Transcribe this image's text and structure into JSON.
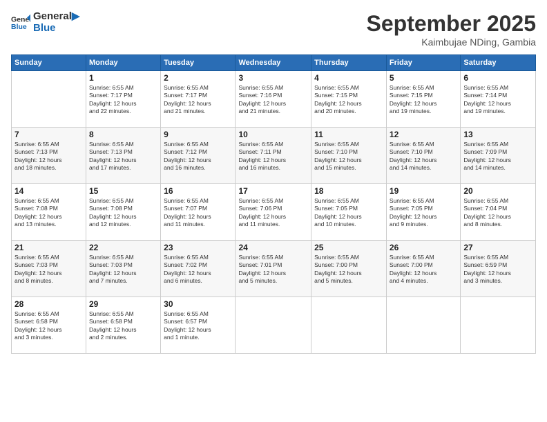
{
  "logo": {
    "line1": "General",
    "line2": "Blue"
  },
  "title": "September 2025",
  "location": "Kaimbujae NDing, Gambia",
  "days_of_week": [
    "Sunday",
    "Monday",
    "Tuesday",
    "Wednesday",
    "Thursday",
    "Friday",
    "Saturday"
  ],
  "weeks": [
    [
      {
        "day": "",
        "info": ""
      },
      {
        "day": "1",
        "info": "Sunrise: 6:55 AM\nSunset: 7:17 PM\nDaylight: 12 hours\nand 22 minutes."
      },
      {
        "day": "2",
        "info": "Sunrise: 6:55 AM\nSunset: 7:17 PM\nDaylight: 12 hours\nand 21 minutes."
      },
      {
        "day": "3",
        "info": "Sunrise: 6:55 AM\nSunset: 7:16 PM\nDaylight: 12 hours\nand 21 minutes."
      },
      {
        "day": "4",
        "info": "Sunrise: 6:55 AM\nSunset: 7:15 PM\nDaylight: 12 hours\nand 20 minutes."
      },
      {
        "day": "5",
        "info": "Sunrise: 6:55 AM\nSunset: 7:15 PM\nDaylight: 12 hours\nand 19 minutes."
      },
      {
        "day": "6",
        "info": "Sunrise: 6:55 AM\nSunset: 7:14 PM\nDaylight: 12 hours\nand 19 minutes."
      }
    ],
    [
      {
        "day": "7",
        "info": "Sunrise: 6:55 AM\nSunset: 7:13 PM\nDaylight: 12 hours\nand 18 minutes."
      },
      {
        "day": "8",
        "info": "Sunrise: 6:55 AM\nSunset: 7:13 PM\nDaylight: 12 hours\nand 17 minutes."
      },
      {
        "day": "9",
        "info": "Sunrise: 6:55 AM\nSunset: 7:12 PM\nDaylight: 12 hours\nand 16 minutes."
      },
      {
        "day": "10",
        "info": "Sunrise: 6:55 AM\nSunset: 7:11 PM\nDaylight: 12 hours\nand 16 minutes."
      },
      {
        "day": "11",
        "info": "Sunrise: 6:55 AM\nSunset: 7:10 PM\nDaylight: 12 hours\nand 15 minutes."
      },
      {
        "day": "12",
        "info": "Sunrise: 6:55 AM\nSunset: 7:10 PM\nDaylight: 12 hours\nand 14 minutes."
      },
      {
        "day": "13",
        "info": "Sunrise: 6:55 AM\nSunset: 7:09 PM\nDaylight: 12 hours\nand 14 minutes."
      }
    ],
    [
      {
        "day": "14",
        "info": "Sunrise: 6:55 AM\nSunset: 7:08 PM\nDaylight: 12 hours\nand 13 minutes."
      },
      {
        "day": "15",
        "info": "Sunrise: 6:55 AM\nSunset: 7:08 PM\nDaylight: 12 hours\nand 12 minutes."
      },
      {
        "day": "16",
        "info": "Sunrise: 6:55 AM\nSunset: 7:07 PM\nDaylight: 12 hours\nand 11 minutes."
      },
      {
        "day": "17",
        "info": "Sunrise: 6:55 AM\nSunset: 7:06 PM\nDaylight: 12 hours\nand 11 minutes."
      },
      {
        "day": "18",
        "info": "Sunrise: 6:55 AM\nSunset: 7:05 PM\nDaylight: 12 hours\nand 10 minutes."
      },
      {
        "day": "19",
        "info": "Sunrise: 6:55 AM\nSunset: 7:05 PM\nDaylight: 12 hours\nand 9 minutes."
      },
      {
        "day": "20",
        "info": "Sunrise: 6:55 AM\nSunset: 7:04 PM\nDaylight: 12 hours\nand 8 minutes."
      }
    ],
    [
      {
        "day": "21",
        "info": "Sunrise: 6:55 AM\nSunset: 7:03 PM\nDaylight: 12 hours\nand 8 minutes."
      },
      {
        "day": "22",
        "info": "Sunrise: 6:55 AM\nSunset: 7:03 PM\nDaylight: 12 hours\nand 7 minutes."
      },
      {
        "day": "23",
        "info": "Sunrise: 6:55 AM\nSunset: 7:02 PM\nDaylight: 12 hours\nand 6 minutes."
      },
      {
        "day": "24",
        "info": "Sunrise: 6:55 AM\nSunset: 7:01 PM\nDaylight: 12 hours\nand 5 minutes."
      },
      {
        "day": "25",
        "info": "Sunrise: 6:55 AM\nSunset: 7:00 PM\nDaylight: 12 hours\nand 5 minutes."
      },
      {
        "day": "26",
        "info": "Sunrise: 6:55 AM\nSunset: 7:00 PM\nDaylight: 12 hours\nand 4 minutes."
      },
      {
        "day": "27",
        "info": "Sunrise: 6:55 AM\nSunset: 6:59 PM\nDaylight: 12 hours\nand 3 minutes."
      }
    ],
    [
      {
        "day": "28",
        "info": "Sunrise: 6:55 AM\nSunset: 6:58 PM\nDaylight: 12 hours\nand 3 minutes."
      },
      {
        "day": "29",
        "info": "Sunrise: 6:55 AM\nSunset: 6:58 PM\nDaylight: 12 hours\nand 2 minutes."
      },
      {
        "day": "30",
        "info": "Sunrise: 6:55 AM\nSunset: 6:57 PM\nDaylight: 12 hours\nand 1 minute."
      },
      {
        "day": "",
        "info": ""
      },
      {
        "day": "",
        "info": ""
      },
      {
        "day": "",
        "info": ""
      },
      {
        "day": "",
        "info": ""
      }
    ]
  ]
}
